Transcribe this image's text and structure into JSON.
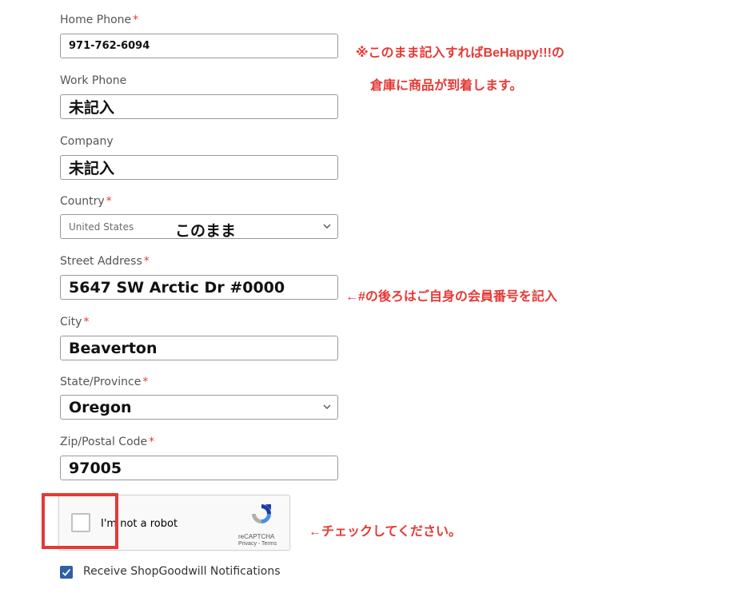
{
  "form": {
    "home_phone": {
      "label": "Home Phone",
      "value": "971-762-6094"
    },
    "work_phone": {
      "label": "Work Phone",
      "value": "未記入"
    },
    "company": {
      "label": "Company",
      "value": "未記入"
    },
    "country": {
      "label": "Country",
      "value": "United States"
    },
    "street_address": {
      "label": "Street Address",
      "value": "5647 SW Arctic Dr  #0000"
    },
    "city": {
      "label": "City",
      "value": "Beaverton"
    },
    "state": {
      "label": "State/Province",
      "value": "Oregon"
    },
    "zip": {
      "label": "Zip/Postal Code",
      "value": "97005"
    },
    "required_mark": "*"
  },
  "notes": {
    "note1_line1": "※このまま記入すればBeHappy!!!の",
    "note1_line2": "倉庫に商品が到着します。",
    "country_overlay": "このまま",
    "address_note": "←#の後ろはご自身の会員番号を記入",
    "captcha_note": "←チェックしてください。"
  },
  "recaptcha": {
    "label": "I'm not a robot",
    "brand": "reCAPTCHA",
    "links": "Privacy - Terms"
  },
  "notifications": {
    "label": "Receive ShopGoodwill Notifications",
    "checked": true
  },
  "colors": {
    "required": "#e53935",
    "note_red": "#e53935",
    "checkbox_blue": "#2f5fa6"
  },
  "icons": [
    "chevron-down-icon",
    "recaptcha-logo-icon",
    "checkmark-icon"
  ]
}
